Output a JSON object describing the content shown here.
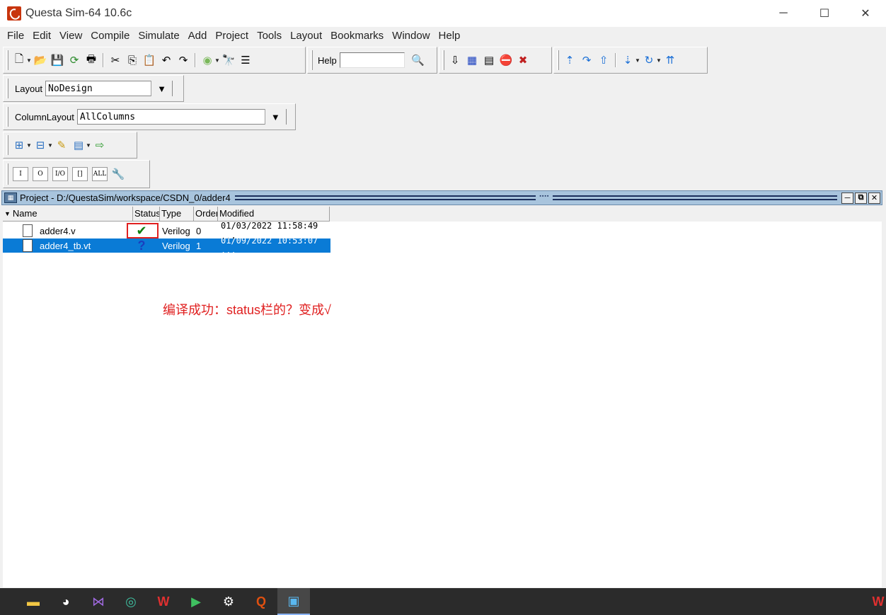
{
  "window": {
    "title": "Questa Sim-64 10.6c"
  },
  "window_controls": [
    "─",
    "☐",
    "✕"
  ],
  "menu": [
    "File",
    "Edit",
    "View",
    "Compile",
    "Simulate",
    "Add",
    "Project",
    "Tools",
    "Layout",
    "Bookmarks",
    "Window",
    "Help"
  ],
  "toolbar": {
    "help_label": "Help"
  },
  "layout_toolbar": {
    "label": "Layout",
    "value": "NoDesign"
  },
  "column_layout_toolbar": {
    "label": "ColumnLayout",
    "value": "AllColumns"
  },
  "wave_toolbar": {
    "buttons": [
      "I",
      "O",
      "I/O",
      "[]",
      "ALL"
    ]
  },
  "project_pane": {
    "title": "Project - D:/QuestaSim/workspace/CSDN_0/adder4",
    "columns": [
      "Name",
      "Status",
      "Type",
      "Order",
      "Modified"
    ],
    "rows": [
      {
        "name": "adder4.v",
        "status": "✔",
        "type": "Verilog",
        "order": "0",
        "modified": "01/03/2022 11:58:49 ...",
        "status_color": "#108010"
      },
      {
        "name": "adder4_tb.vt",
        "status": "?",
        "type": "Verilog",
        "order": "1",
        "modified": "01/09/2022 10:53:07 ...",
        "status_color": "#1a3fbf"
      }
    ],
    "annotation": "编译成功：status栏的？变成√"
  },
  "colors": {
    "accent": "#0a7bd6",
    "annotation": "#e02020",
    "pane_header": "#a8c4dd"
  },
  "taskbar_icons": [
    "file-explorer-icon",
    "qq-icon",
    "visual-studio-icon",
    "edge-icon",
    "wps-icon",
    "media-player-icon",
    "settings-icon",
    "questa-icon",
    "app-icon"
  ]
}
